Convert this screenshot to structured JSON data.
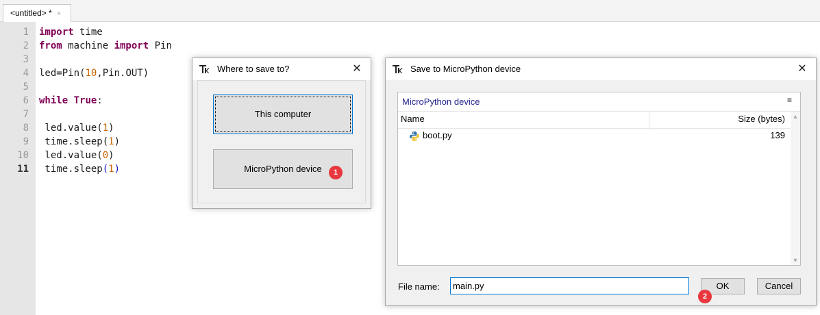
{
  "editor": {
    "tab_label": "<untitled> *",
    "tab_close": "×",
    "line_numbers": [
      "1",
      "2",
      "3",
      "4",
      "5",
      "6",
      "7",
      "8",
      "9",
      "10",
      "11"
    ],
    "lines": [
      [
        {
          "t": "import",
          "k": "kw"
        },
        {
          "t": " time",
          "k": ""
        }
      ],
      [
        {
          "t": "from",
          "k": "kw"
        },
        {
          "t": " machine ",
          "k": ""
        },
        {
          "t": "import",
          "k": "kw"
        },
        {
          "t": " Pin",
          "k": ""
        }
      ],
      [],
      [
        {
          "t": "led=Pin(",
          "k": ""
        },
        {
          "t": "10",
          "k": "num"
        },
        {
          "t": ",Pin.OUT)",
          "k": ""
        }
      ],
      [],
      [
        {
          "t": "while",
          "k": "kw"
        },
        {
          "t": " ",
          "k": ""
        },
        {
          "t": "True",
          "k": "kw"
        },
        {
          "t": ":",
          "k": ""
        }
      ],
      [],
      [
        {
          "t": " led.value(",
          "k": ""
        },
        {
          "t": "1",
          "k": "num"
        },
        {
          "t": ")",
          "k": ""
        }
      ],
      [
        {
          "t": " time.sleep(",
          "k": ""
        },
        {
          "t": "1",
          "k": "num"
        },
        {
          "t": ")",
          "k": ""
        }
      ],
      [
        {
          "t": " led.value(",
          "k": ""
        },
        {
          "t": "0",
          "k": "num"
        },
        {
          "t": ")",
          "k": ""
        }
      ],
      [
        {
          "t": " time.sleep",
          "k": ""
        },
        {
          "t": "(",
          "k": "par"
        },
        {
          "t": "1",
          "k": "num"
        },
        {
          "t": ")",
          "k": "par"
        }
      ]
    ]
  },
  "save_dialog": {
    "title": "Where to save to?",
    "this_computer": "This computer",
    "micropython_device": "MicroPython device",
    "badge": "1"
  },
  "device_dialog": {
    "title": "Save to MicroPython device",
    "location": "MicroPython device",
    "menu_icon": "≡",
    "col_name": "Name",
    "col_size": "Size (bytes)",
    "files": [
      {
        "name": "boot.py",
        "size": "139"
      }
    ],
    "file_name_label": "File name:",
    "file_name_value": "main.py",
    "ok": "OK",
    "cancel": "Cancel",
    "badge": "2"
  },
  "icons": {
    "app_icon": "thonny-icon",
    "close": "close-icon",
    "python_file": "python-file-icon"
  },
  "colors": {
    "keyword": "#7f0055",
    "number": "#c86400",
    "paren": "#1414c8",
    "badge": "#e8383d",
    "focus": "#0078d7"
  }
}
